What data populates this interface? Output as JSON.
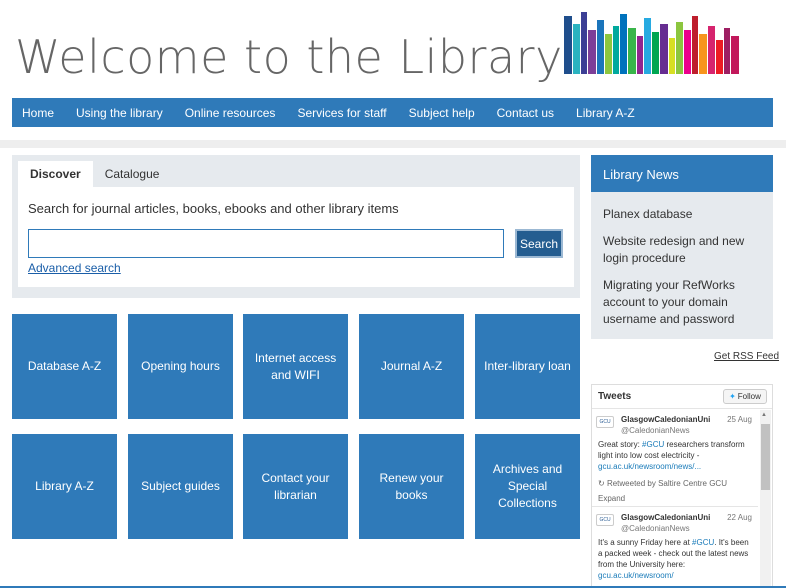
{
  "header": {
    "title": "Welcome to the Library"
  },
  "nav": {
    "items": [
      "Home",
      "Using the library",
      "Online resources",
      "Services for staff",
      "Subject help",
      "Contact us",
      "Library A-Z"
    ]
  },
  "search": {
    "tabs": [
      "Discover",
      "Catalogue"
    ],
    "active_tab": "Discover",
    "description": "Search for journal articles, books, ebooks and other library items",
    "input_value": "",
    "button_label": "Search",
    "advanced_link": "Advanced search"
  },
  "tiles": {
    "row1": [
      "Database A-Z",
      "Opening hours",
      "Internet access and WIFI",
      "Journal A-Z",
      "Inter-library loan"
    ],
    "row2": [
      "Library A-Z",
      "Subject guides",
      "Contact your librarian",
      "Renew your books",
      "Archives and Special Collections"
    ]
  },
  "news": {
    "title": "Library News",
    "items": [
      "Planex database",
      "Website redesign and new login procedure",
      "Migrating your RefWorks account to your domain username and password"
    ],
    "rss_link": "Get RSS Feed"
  },
  "tweets": {
    "title": "Tweets",
    "follow_label": "Follow",
    "items": [
      {
        "avatar": "GCU",
        "name": "GlasgowCaledonianUni",
        "handle": "@CaledonianNews",
        "date": "25 Aug",
        "text_before": "Great story: ",
        "hashtag": "#GCU",
        "text_after": " researchers transform light into low cost electricity - ",
        "link": "gcu.ac.uk/newsroom/news/...",
        "retweet": "Retweeted by Saltire Centre GCU",
        "expand": "Expand"
      },
      {
        "avatar": "GCU",
        "name": "GlasgowCaledonianUni",
        "handle": "@CaledonianNews",
        "date": "22 Aug",
        "text_before": "It's a sunny Friday here at ",
        "hashtag": "#GCU",
        "text_after": ". It's been a packed week - check out the latest news from the University here: ",
        "link": "gcu.ac.uk/newsroom/"
      }
    ]
  },
  "colors": {
    "primary_blue": "#2f7ab9",
    "panel_grey": "#e6eaee",
    "search_button": "#245d90"
  },
  "icons": {
    "follow": "twitter-bird-icon",
    "retweet": "retweet-icon",
    "logo": "book-spines-logo"
  }
}
